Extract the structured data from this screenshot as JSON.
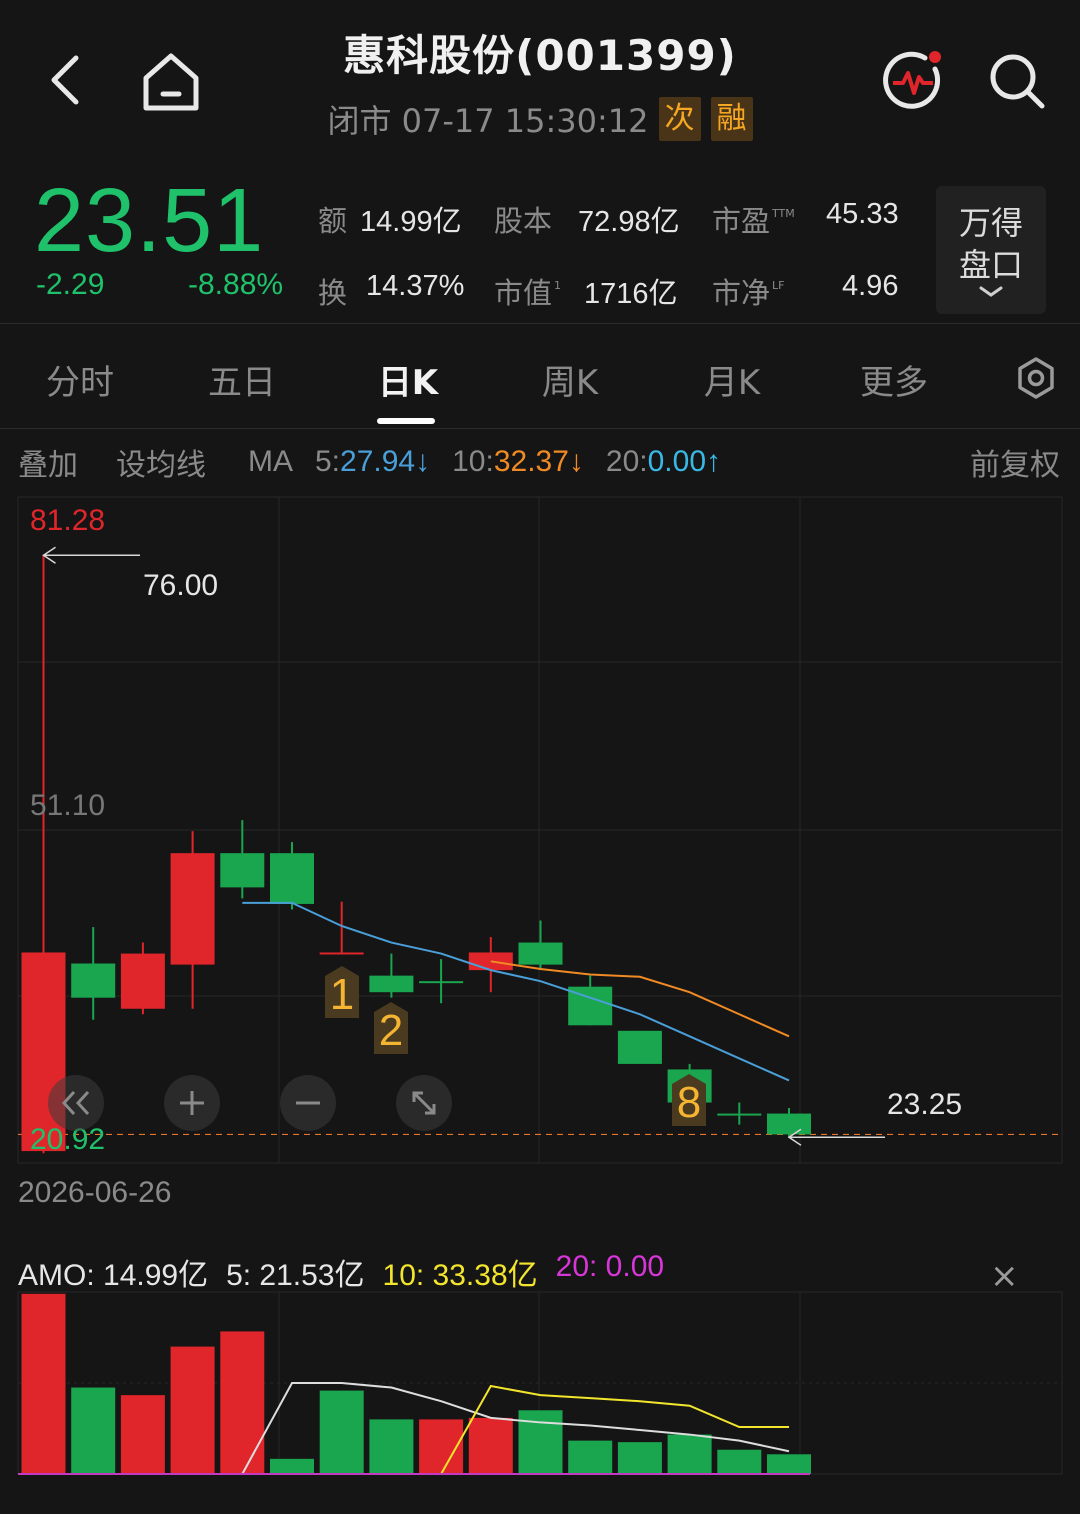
{
  "header": {
    "title": "惠科股份(001399)",
    "status": "闭市 07-17 15:30:12",
    "badge_1": "次",
    "badge_2": "融"
  },
  "quote": {
    "price": "23.51",
    "change": "-2.29",
    "change_pct": "-8.88%",
    "turnover_amount_label": "额",
    "turnover_amount": "14.99亿",
    "turnover_rate_label": "换",
    "turnover_rate": "14.37%",
    "share_capital_label": "股本",
    "share_capital": "72.98亿",
    "market_cap_label": "市值",
    "market_cap_sup": "1",
    "market_cap": "1716亿",
    "pe_label": "市盈",
    "pe_sup": "TTM",
    "pe": "45.33",
    "pb_label": "市净",
    "pb_sup": "LF",
    "pb": "4.96",
    "wind_line1": "万得",
    "wind_line2": "盘口"
  },
  "tabs": [
    {
      "label": "分时",
      "active": false
    },
    {
      "label": "五日",
      "active": false
    },
    {
      "label": "日K",
      "active": true
    },
    {
      "label": "周K",
      "active": false
    },
    {
      "label": "月K",
      "active": false
    },
    {
      "label": "更多",
      "active": false
    }
  ],
  "toolbar": {
    "overlay": "叠加",
    "set_ma": "设均线",
    "ma_label": "MA",
    "ma5_key": "5:",
    "ma5_val": "27.94",
    "ma10_key": "10:",
    "ma10_val": "32.37",
    "ma20_key": "20:",
    "ma20_val": "0.00",
    "adjust": "前复权"
  },
  "kline": {
    "max_label": "81.28",
    "mid_label": "51.10",
    "min_label": "20.92",
    "high_marker": "76.00",
    "low_marker": "23.25",
    "date": "2026-06-26",
    "markers": [
      "1",
      "2",
      "8"
    ]
  },
  "amo": {
    "label": "AMO: 14.99亿",
    "ma5": "5: 21.53亿",
    "ma10": "10: 33.38亿",
    "ma20": "20: 0.00",
    "close": "×"
  },
  "chart_data": [
    {
      "type": "candlestick",
      "title": "",
      "ylim": [
        20.92,
        81.28
      ],
      "candles": [
        {
          "open": 22.0,
          "close": 40.0,
          "high": 76.0,
          "low": 21.8
        },
        {
          "open": 39.0,
          "close": 35.9,
          "high": 42.3,
          "low": 33.9
        },
        {
          "open": 34.9,
          "close": 39.9,
          "high": 40.9,
          "low": 34.4
        },
        {
          "open": 38.9,
          "close": 49.0,
          "high": 51.0,
          "low": 34.9
        },
        {
          "open": 49.0,
          "close": 45.9,
          "high": 52.0,
          "low": 44.9
        },
        {
          "open": 49.0,
          "close": 44.4,
          "high": 50.0,
          "low": 43.9
        },
        {
          "open": 40.0,
          "close": 40.0,
          "high": 44.6,
          "low": 40.0
        },
        {
          "open": 37.9,
          "close": 36.4,
          "high": 39.9,
          "low": 35.9
        },
        {
          "open": 37.4,
          "close": 37.4,
          "high": 39.4,
          "low": 35.4
        },
        {
          "open": 38.4,
          "close": 40.0,
          "high": 41.4,
          "low": 36.4
        },
        {
          "open": 40.9,
          "close": 38.9,
          "high": 42.9,
          "low": 38.4
        },
        {
          "open": 36.9,
          "close": 33.4,
          "high": 37.9,
          "low": 33.4
        },
        {
          "open": 32.9,
          "close": 29.9,
          "high": 32.9,
          "low": 29.9
        },
        {
          "open": 29.4,
          "close": 26.4,
          "high": 29.9,
          "low": 26.4
        },
        {
          "open": 25.4,
          "close": 25.4,
          "high": 26.4,
          "low": 24.4
        },
        {
          "open": 25.4,
          "close": 23.51,
          "high": 25.9,
          "low": 23.25
        }
      ],
      "ma5": [
        null,
        null,
        null,
        null,
        44.5,
        44.5,
        42.4,
        40.9,
        39.9,
        38.4,
        37.4,
        35.9,
        34.4,
        32.4,
        30.4,
        28.4
      ],
      "ma10": [
        null,
        null,
        null,
        null,
        null,
        null,
        null,
        null,
        null,
        39.2,
        38.5,
        38.0,
        37.8,
        36.4,
        34.4,
        32.4
      ]
    },
    {
      "type": "bar",
      "title": "",
      "ylim": [
        0,
        60
      ],
      "values": [
        59.4,
        28.5,
        26.0,
        42.0,
        47.0,
        5.0,
        27.5,
        18.0,
        18.0,
        18.5,
        21.0,
        11.0,
        10.5,
        13.0,
        8.0,
        6.5
      ],
      "up": [
        true,
        false,
        true,
        true,
        true,
        false,
        false,
        false,
        true,
        true,
        false,
        false,
        false,
        false,
        false,
        false
      ],
      "ma5": [
        null,
        null,
        null,
        null,
        0.0,
        30.0,
        30.0,
        28.5,
        24.0,
        18.5,
        17.0,
        16.0,
        14.5,
        13.0,
        11.0,
        7.5
      ],
      "ma10": [
        null,
        null,
        null,
        null,
        null,
        null,
        null,
        null,
        0.0,
        29.0,
        26.0,
        25.0,
        24.0,
        22.5,
        15.5,
        15.5
      ]
    }
  ],
  "colors": {
    "up": "#e0252b",
    "down": "#1aa64f",
    "ma5": "#4a9fd8",
    "ma10": "#f08a24",
    "vol_ma5": "#dddddd",
    "vol_ma10": "#f2e52c",
    "price_green": "#1fc16b"
  }
}
